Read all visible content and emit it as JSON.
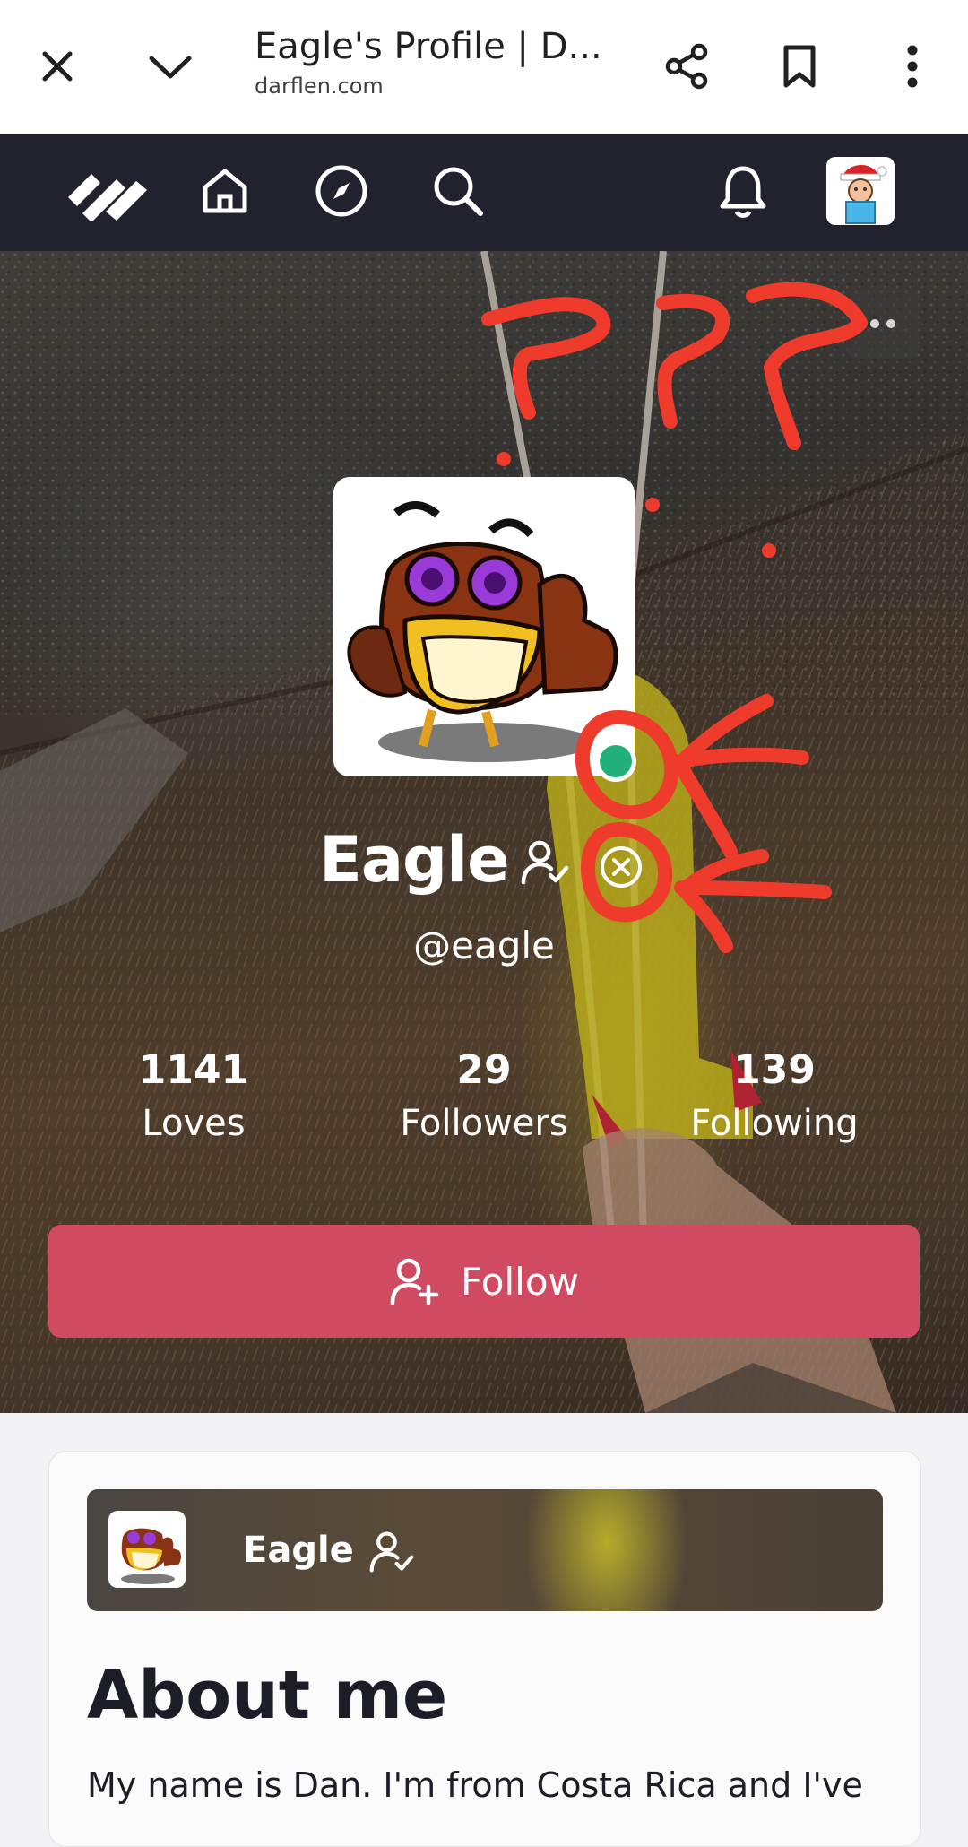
{
  "browser": {
    "title": "Eagle's Profile | D...",
    "url": "darflen.com",
    "icons": [
      "close-icon",
      "chevron-down-icon",
      "share-icon",
      "bookmark-icon",
      "more-vertical-icon"
    ]
  },
  "nav": {
    "icons": [
      "logo-icon",
      "home-icon",
      "explore-icon",
      "search-icon",
      "bell-icon",
      "user-avatar"
    ]
  },
  "profile": {
    "name": "Eagle",
    "handle": "@eagle",
    "stats": [
      {
        "value": "1141",
        "label": "Loves"
      },
      {
        "value": "29",
        "label": "Followers"
      },
      {
        "value": "139",
        "label": "Following"
      }
    ],
    "follow_label": "Follow",
    "status": "online"
  },
  "about": {
    "banner_name": "Eagle",
    "title": "About me",
    "text": "My name is Dan. I'm from Costa Rica and I've"
  },
  "colors": {
    "follow_button": "#d04a62",
    "nav_bg": "#22222e",
    "online": "#21b07a",
    "annotation": "#ef3b2c"
  }
}
